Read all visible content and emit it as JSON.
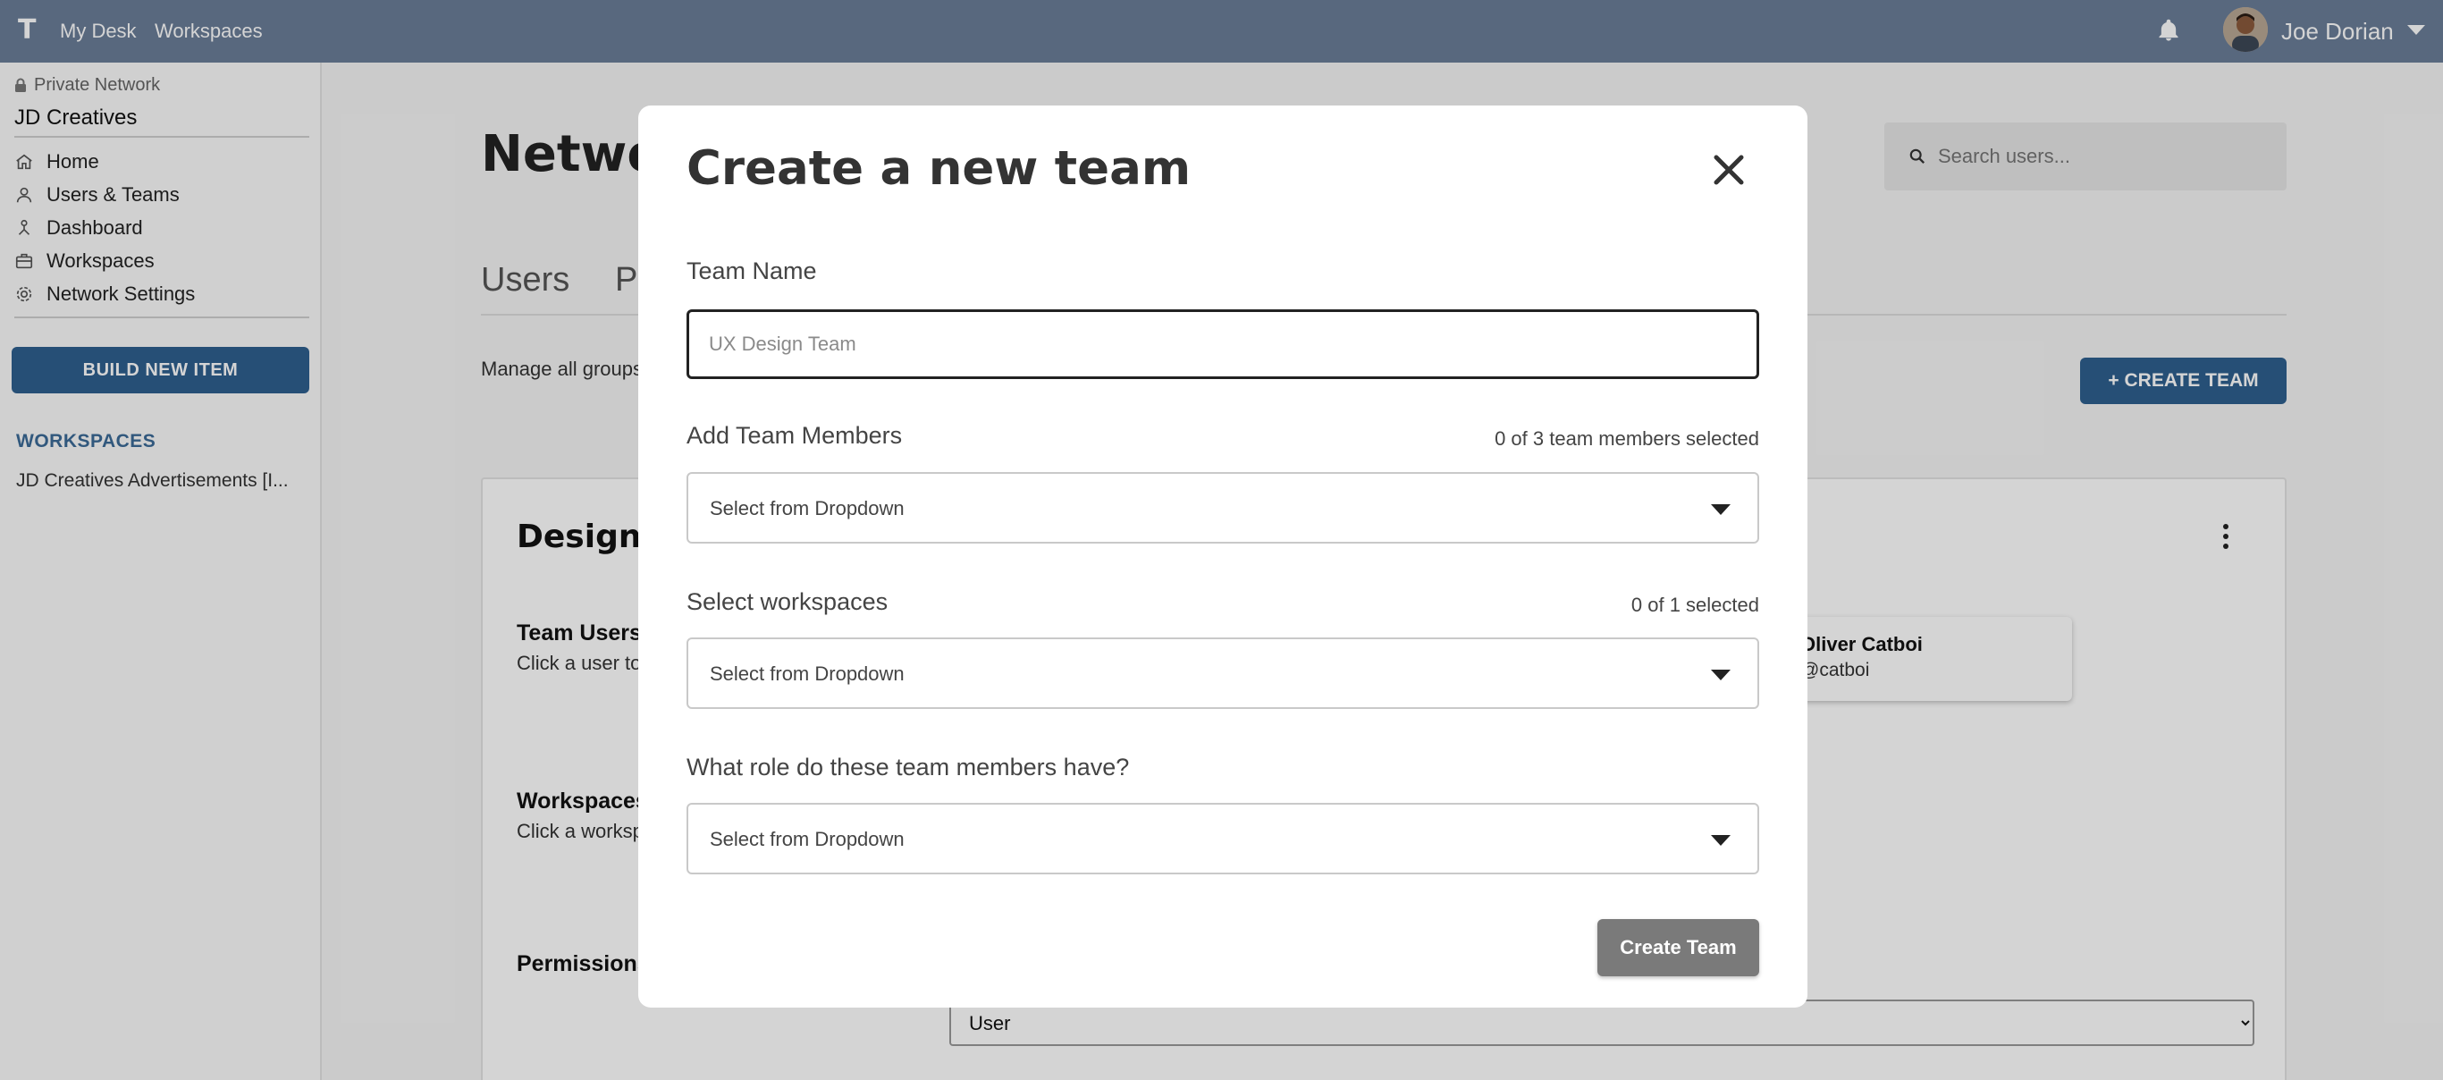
{
  "topbar": {
    "logo": "T",
    "nav": [
      "My Desk",
      "Workspaces"
    ],
    "user_name": "Joe Dorian"
  },
  "sidebar": {
    "network_label": "Private Network",
    "network_name": "JD Creatives",
    "items": [
      {
        "label": "Home",
        "icon": "home-icon"
      },
      {
        "label": "Users & Teams",
        "icon": "user-icon"
      },
      {
        "label": "Dashboard",
        "icon": "dashboard-icon"
      },
      {
        "label": "Workspaces",
        "icon": "briefcase-icon"
      },
      {
        "label": "Network Settings",
        "icon": "gear-icon"
      }
    ],
    "build_button": "BUILD NEW ITEM",
    "workspaces_heading": "WORKSPACES",
    "workspaces": [
      "JD Creatives Advertisements [I..."
    ]
  },
  "main": {
    "title": "Networ",
    "search_placeholder": "Search users...",
    "tabs": [
      "Users",
      "Pe"
    ],
    "manage_text": "Manage all groups",
    "create_team_button": "CREATE TEAM",
    "card": {
      "title": "Designer",
      "team_users_heading": "Team Users",
      "team_users_desc": "Click a user to team",
      "workspaces_heading": "Workspaces",
      "workspaces_desc": "Click a worksp the team",
      "permissions_heading": "Permissions",
      "user_card": {
        "name": "Oliver Catboi",
        "handle": "@catboi"
      },
      "role_value": "User"
    }
  },
  "modal": {
    "title": "Create a new team",
    "team_name_label": "Team Name",
    "team_name_placeholder": "UX Design Team",
    "members_label": "Add Team Members",
    "members_count": "0 of 3 team members selected",
    "members_select": "Select from Dropdown",
    "workspaces_label": "Select workspaces",
    "workspaces_count": "0 of 1 selected",
    "workspaces_select": "Select from Dropdown",
    "role_label": "What role do these team members have?",
    "role_select": "Select from Dropdown",
    "submit_button": "Create Team"
  },
  "colors": {
    "topbar": "#6a7d98",
    "primary_button": "#2e5f8f",
    "disabled_button": "#7a7a7a",
    "workspaces_heading": "#3c6a97"
  }
}
